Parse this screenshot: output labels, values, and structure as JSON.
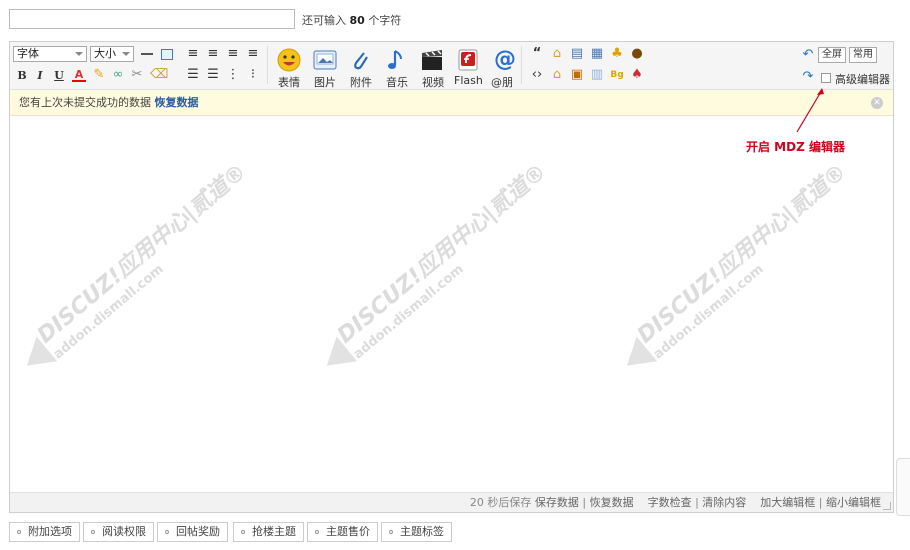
{
  "title_field": {
    "value": "",
    "hint_prefix": "还可输入",
    "hint_count": "80",
    "hint_suffix": "个字符"
  },
  "toolbar": {
    "font_select": "字体",
    "size_select": "大小",
    "format_row1": [
      "horizontal-rule",
      "table",
      "align-left",
      "align-center",
      "align-right",
      "align-justify"
    ],
    "format_row2": [
      "B",
      "I",
      "U",
      "A"
    ],
    "media": [
      {
        "label": "表情",
        "icon": "smiley-icon"
      },
      {
        "label": "图片",
        "icon": "image-icon"
      },
      {
        "label": "附件",
        "icon": "paperclip-icon"
      },
      {
        "label": "音乐",
        "icon": "music-note-icon"
      },
      {
        "label": "视频",
        "icon": "clapperboard-icon"
      },
      {
        "label": "Flash",
        "icon": "flash-icon"
      },
      {
        "label": "@朋",
        "icon": "at-icon"
      }
    ],
    "fullscreen_label": "全屏",
    "common_label": "常用",
    "advanced_label": "高级编辑器"
  },
  "notice": {
    "text": "您有上次未提交成功的数据",
    "restore_link": "恢复数据"
  },
  "watermark": {
    "line1": "DISCUZ!应用中心|贰道®",
    "line2": "addon.dismall.com"
  },
  "annotation": {
    "text": "开启 MDZ 编辑器",
    "color": "#d0021b"
  },
  "statusbar": {
    "autosave_prefix": "20 秒后保存",
    "save_data": "保存数据",
    "restore_data": "恢复数据",
    "word_check": "字数检查",
    "clear_content": "清除内容",
    "enlarge": "加大编辑框",
    "shrink": "缩小编辑框"
  },
  "options": [
    "附加选项",
    "阅读权限",
    "回帖奖励",
    "抢楼主题",
    "主题售价",
    "主题标签"
  ]
}
